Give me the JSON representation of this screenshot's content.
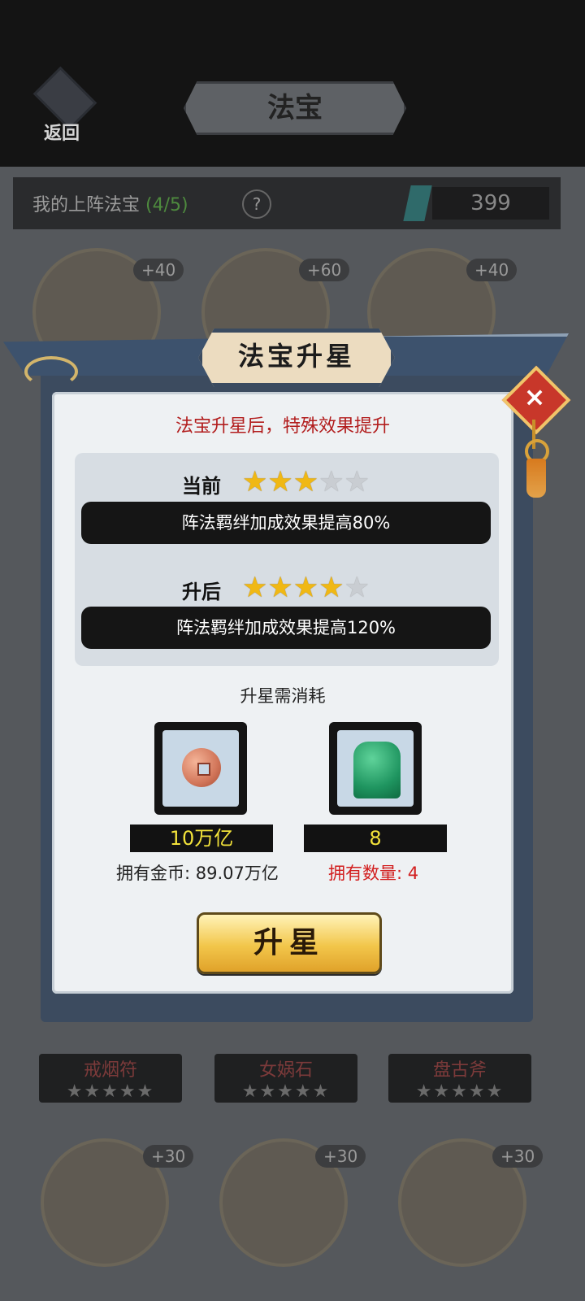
{
  "header": {
    "back_label": "返回",
    "title": "法宝"
  },
  "lineup": {
    "label": "我的上阵法宝",
    "count": "(4/5)",
    "help": "?",
    "currency": "399"
  },
  "background_treasures": [
    {
      "bonus": "+40"
    },
    {
      "bonus": "+60"
    },
    {
      "bonus": "+40"
    }
  ],
  "background_named": [
    {
      "name": "戒烟符",
      "stars": "★★★★★"
    },
    {
      "name": "女娲石",
      "stars": "★★★★★"
    },
    {
      "name": "盘古斧",
      "stars": "★★★★★"
    }
  ],
  "background_bottom": [
    {
      "bonus": "+30"
    },
    {
      "bonus": "+30"
    },
    {
      "bonus": "+30"
    }
  ],
  "dialog": {
    "title": "法宝升星",
    "close_icon": "×",
    "subtitle": "法宝升星后，特殊效果提升",
    "current": {
      "label": "当前",
      "stars_filled": 3,
      "stars_total": 5,
      "effect": "阵法羁绊加成效果提高80%"
    },
    "after": {
      "label": "升后",
      "stars_filled": 4,
      "stars_total": 5,
      "effect": "阵法羁绊加成效果提高120%"
    },
    "cost_title": "升星需消耗",
    "costs": [
      {
        "icon": "copper-coin-icon",
        "amount": "10万亿",
        "owned": "拥有金币: 89.07万亿",
        "owned_color": "#222222"
      },
      {
        "icon": "jade-seal-icon",
        "amount": "8",
        "owned": "拥有数量: 4",
        "owned_color": "#d21e1e"
      }
    ],
    "upgrade_button": "升星"
  },
  "colors": {
    "accent_red": "#b21d1d",
    "gold": "#f0b814",
    "panel_frame": "#3c4b5f"
  }
}
